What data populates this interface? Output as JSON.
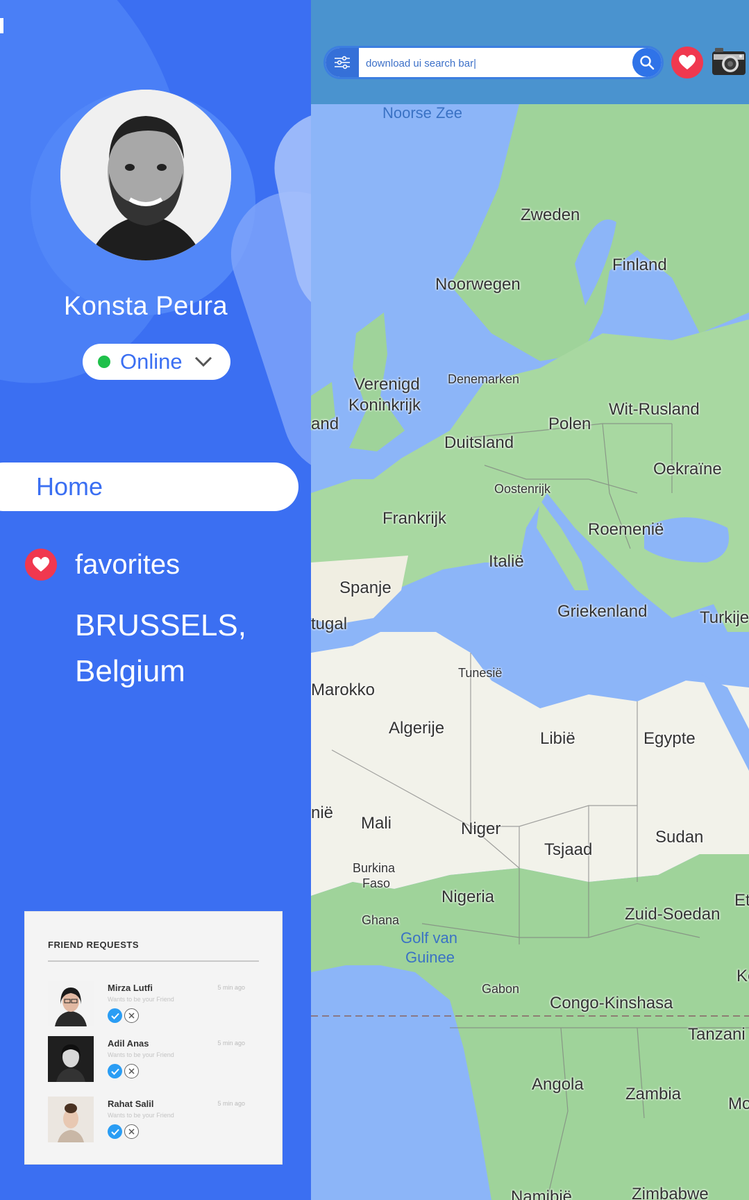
{
  "profile": {
    "name": "Konsta Peura",
    "status": "Online"
  },
  "nav": {
    "home": "Home",
    "favorites": "favorites"
  },
  "location": {
    "line1": "BRUSSELS,",
    "line2": "Belgium"
  },
  "friend_requests": {
    "title": "FRIEND REQUESTS",
    "items": [
      {
        "name": "Mirza Lutfi",
        "time": "5 min ago",
        "subtitle": "Wants to be your Friend"
      },
      {
        "name": "Adil Anas",
        "time": "5 min ago",
        "subtitle": "Wants to be your Friend"
      },
      {
        "name": "Rahat Salil",
        "time": "5 min ago",
        "subtitle": "Wants to be your Friend"
      }
    ]
  },
  "search": {
    "value": "download ui search bar|"
  },
  "map": {
    "labels": {
      "noorse_zee": "Noorse Zee",
      "zweden": "Zweden",
      "finland": "Finland",
      "noorwegen": "Noorwegen",
      "verenigd": "Verenigd",
      "koninkrijk": "Koninkrijk",
      "denemarken": "Denemarken",
      "ierland_partial": "and",
      "wit_rusland": "Wit-Rusland",
      "polen": "Polen",
      "duitsland": "Duitsland",
      "oekraine": "Oekraïne",
      "oostenrijk": "Oostenrijk",
      "frankrijk": "Frankrijk",
      "roemenie": "Roemenië",
      "italie": "Italië",
      "spanje": "Spanje",
      "griekenland": "Griekenland",
      "turkije": "Turkije",
      "portugal_partial": "tugal",
      "tunesie": "Tunesië",
      "marokko_partial": "Marokko",
      "algerije": "Algerije",
      "libie": "Libië",
      "egypte": "Egypte",
      "mauritanie_partial": "nië",
      "mali": "Mali",
      "niger": "Niger",
      "tsjaad": "Tsjaad",
      "sudan": "Sudan",
      "burkina": "Burkina",
      "faso": "Faso",
      "nigeria": "Nigeria",
      "ghana": "Ghana",
      "zuid_soedan": "Zuid-Soedan",
      "ethiopie_partial": "Et",
      "golf_van": "Golf van",
      "guinee": "Guinee",
      "gabon": "Gabon",
      "kenia_partial": "Ke",
      "congo_kinshasa": "Congo-Kinshasa",
      "tanzania_partial": "Tanzani",
      "angola": "Angola",
      "zambia": "Zambia",
      "mozambique_partial": "Mo",
      "namibie_partial": "Namibië",
      "zimbabwe_partial": "Zimbabwe"
    }
  },
  "colors": {
    "sidebar_blue": "#3b6ff2",
    "online_green": "#1fc04a",
    "heart_red": "#f0384f",
    "sea": "#8cb5f8",
    "land": "#9fd39a",
    "desert": "#f2f2ea"
  }
}
